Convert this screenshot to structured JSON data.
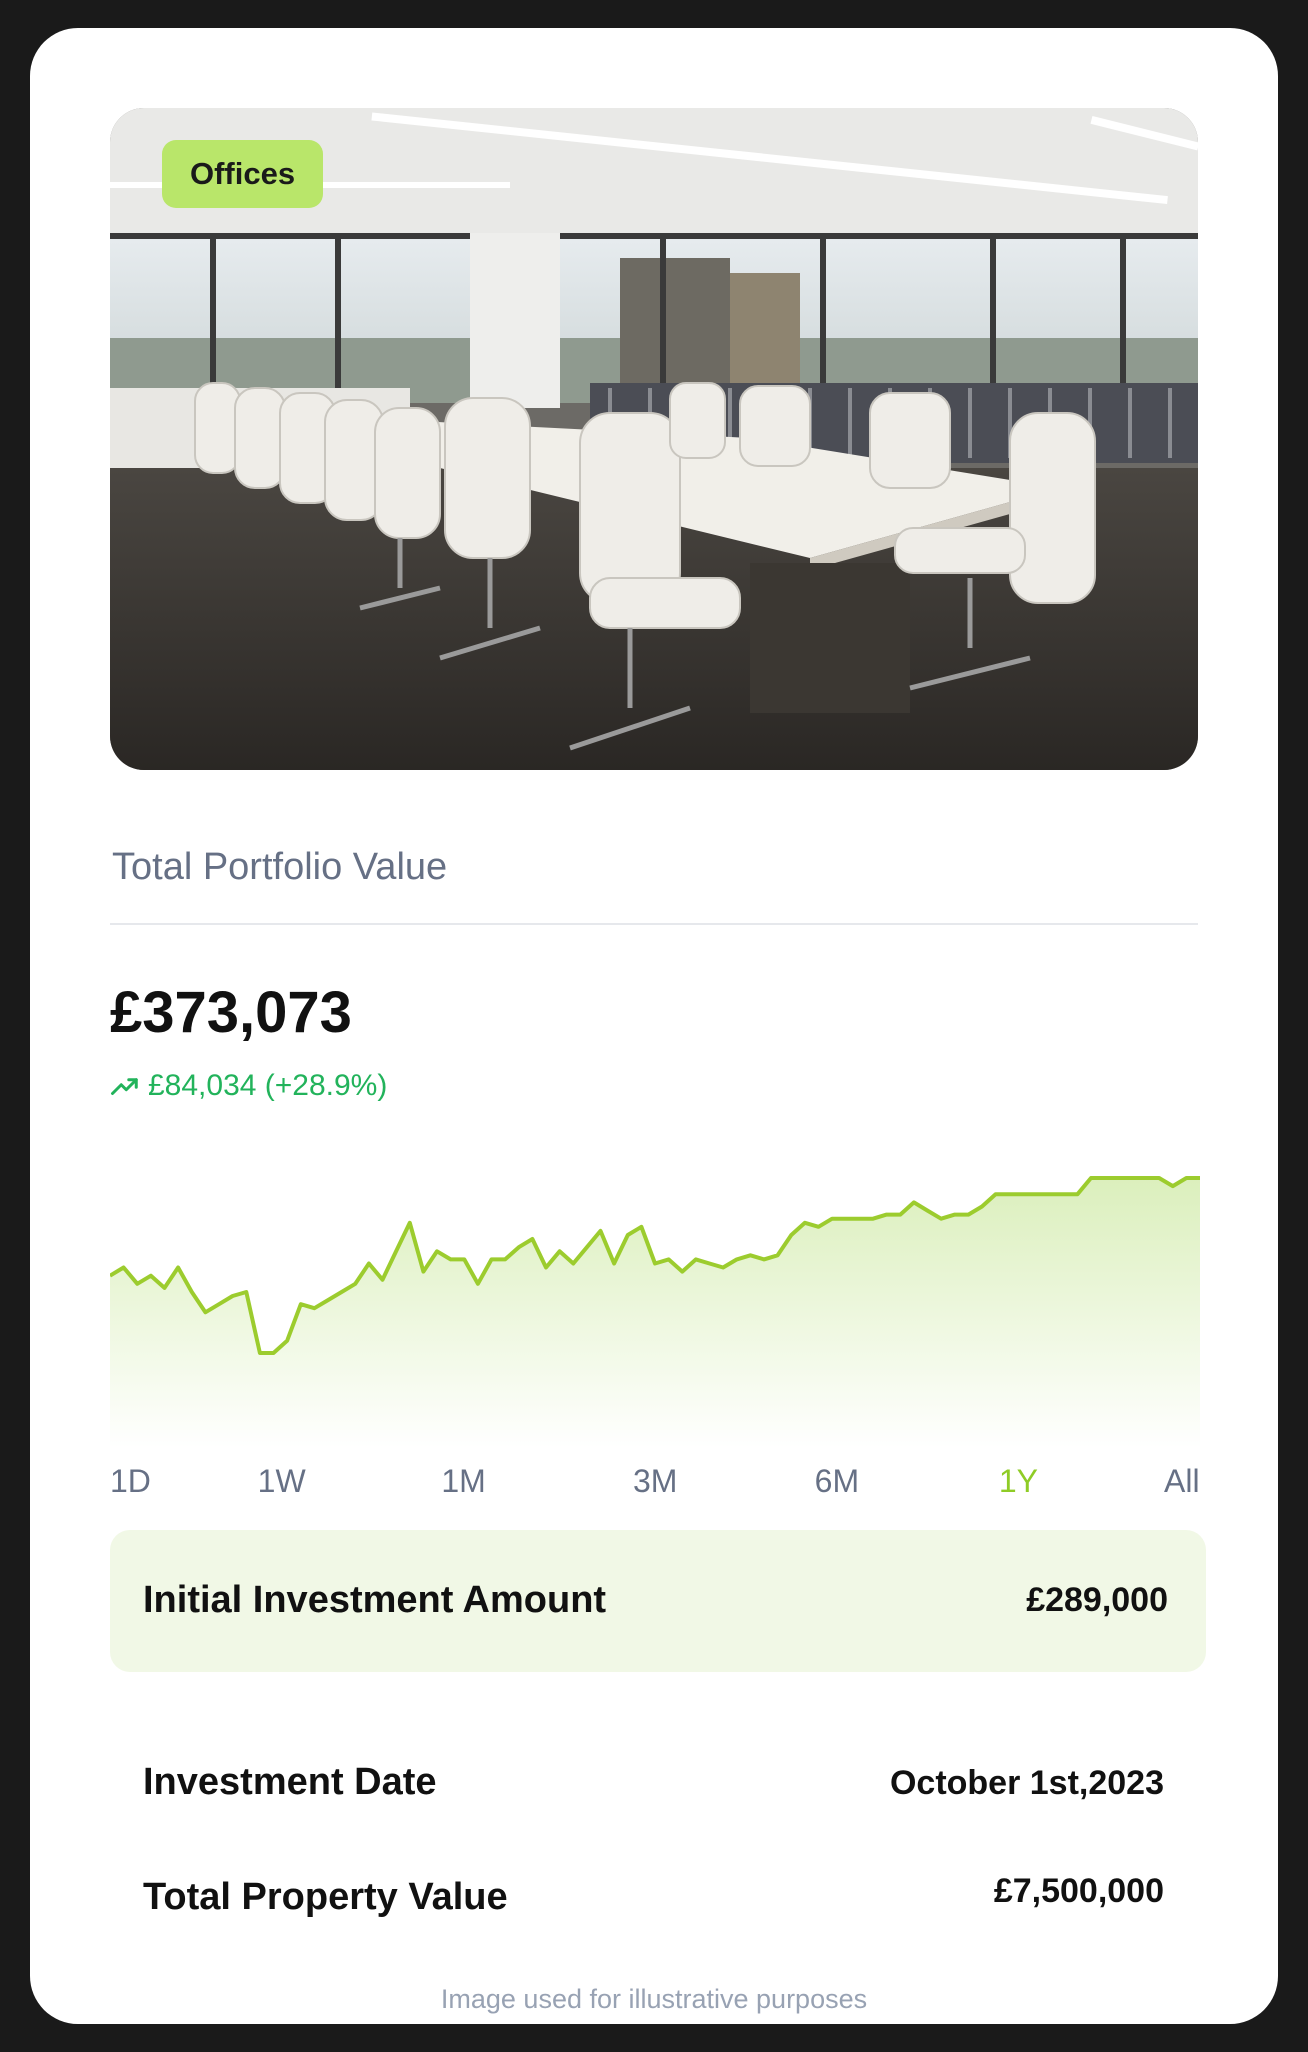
{
  "property": {
    "category_badge": "Offices",
    "image_icon": "conference-room-photo"
  },
  "portfolio": {
    "section_title": "Total Portfolio Value",
    "total_value": "£373,073",
    "change_text": "£84,034 (+28.9%)",
    "change_icon": "trending-up-icon",
    "change_color": "#22b35b"
  },
  "chart_data": {
    "type": "area",
    "title": "",
    "xlabel": "",
    "ylabel": "",
    "series": [
      {
        "values": [
          300,
          302,
          298,
          300,
          297,
          302,
          296,
          291,
          293,
          295,
          296,
          281,
          281,
          284,
          293,
          292,
          294,
          296,
          298,
          303,
          299,
          306,
          313,
          301,
          306,
          304,
          304,
          298,
          304,
          304,
          307,
          309,
          302,
          306,
          303,
          307,
          311,
          303,
          310,
          312,
          303,
          304,
          301,
          304,
          303,
          302,
          304,
          305,
          304,
          305,
          310,
          313,
          312,
          314,
          314,
          314,
          314,
          315,
          315,
          318,
          316,
          314,
          315,
          315,
          317,
          320,
          320,
          320,
          320,
          320,
          320,
          320,
          324,
          324,
          324,
          324,
          324,
          324,
          322,
          324,
          324
        ],
        "color": "#9ccc2e"
      }
    ],
    "fill_gradient": [
      "#dbefbc",
      "#ffffff"
    ],
    "grid": false,
    "legend": "none"
  },
  "time_ranges": {
    "options": [
      "1D",
      "1W",
      "1M",
      "3M",
      "6M",
      "1Y",
      "All"
    ],
    "selected": "1Y",
    "active_color": "#8fcc26"
  },
  "details": {
    "initial_investment_label": "Initial Investment Amount",
    "initial_investment_value": "£289,000",
    "investment_date_label": "Investment Date",
    "investment_date_value": "October 1st,2023",
    "property_value_label": "Total  Property Value",
    "property_value_value": "£7,500,000"
  },
  "footnote": "Image used for illustrative purposes"
}
